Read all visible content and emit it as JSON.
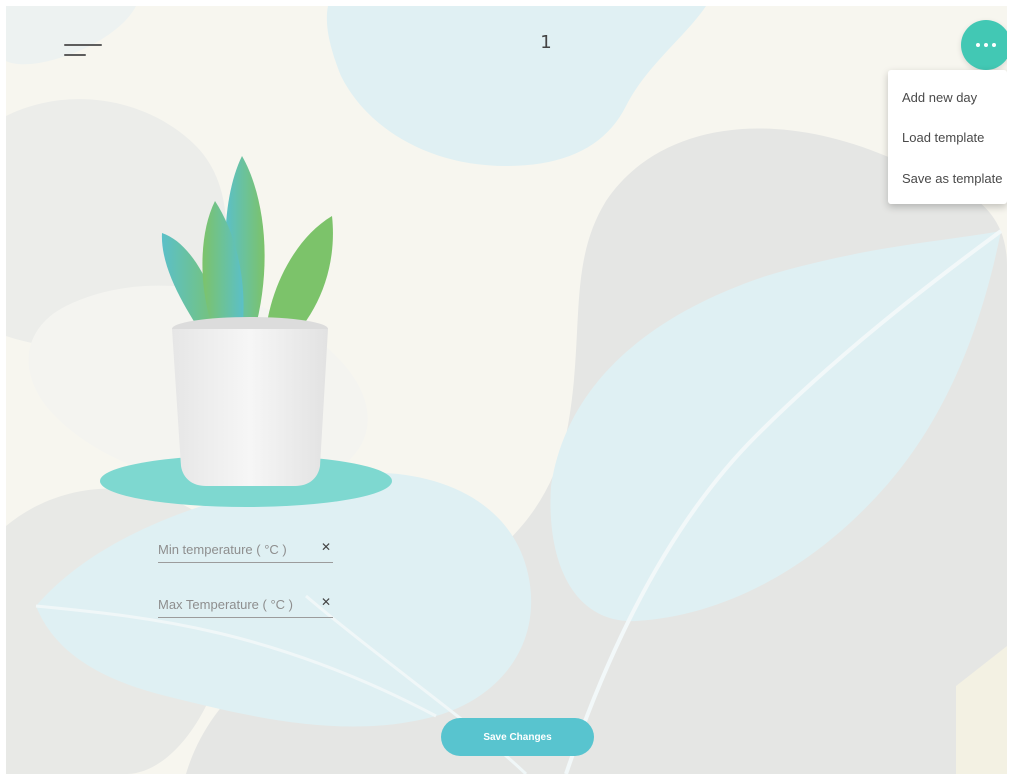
{
  "header": {
    "day_number": "1",
    "menu_icon": "hamburger-menu-icon",
    "more_icon": "more-horizontal-icon"
  },
  "dropdown": {
    "items": [
      {
        "label": "Add new day"
      },
      {
        "label": "Load template"
      },
      {
        "label": "Save as template"
      }
    ]
  },
  "form": {
    "min_temperature": {
      "placeholder": "Min temperature ( °C )",
      "value": ""
    },
    "max_temperature": {
      "placeholder": "Max Temperature ( °C )",
      "value": ""
    },
    "clear_icon": "close-icon"
  },
  "footer": {
    "save_label": "Save Changes"
  },
  "colors": {
    "accent": "#42c8b4",
    "button": "#58c4cf",
    "saucer": "#7ed8d0",
    "leaf_green": "#7cc36a",
    "leaf_blue": "#5bc0c8"
  }
}
